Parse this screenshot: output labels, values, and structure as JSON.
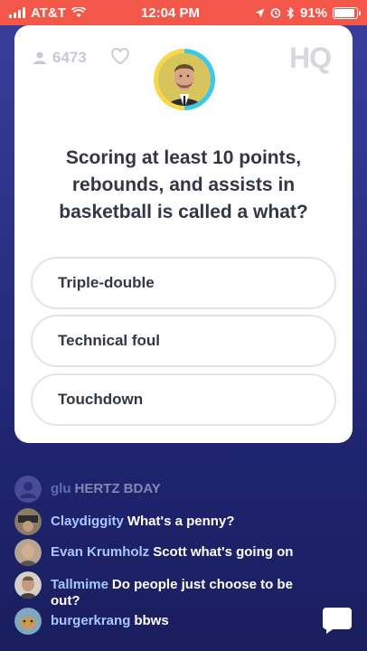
{
  "status_bar": {
    "carrier": "AT&T",
    "time": "12:04 PM",
    "battery": "91%",
    "battery_level": 0.91
  },
  "card": {
    "viewer_count": "6473",
    "logo": "HQ",
    "question": "Scoring at least 10 points, rebounds, and assists in basketball is called a what?",
    "answers": [
      {
        "label": "Triple-double"
      },
      {
        "label": "Technical foul"
      },
      {
        "label": "Touchdown"
      }
    ]
  },
  "chat": {
    "messages": [
      {
        "user": "glu",
        "text": "HERTZ BDAY"
      },
      {
        "user": "Claydiggity",
        "text": "What's a penny?"
      },
      {
        "user": "Evan Krumholz",
        "text": "Scott what's going on"
      },
      {
        "user": "Tallmime",
        "text": "Do people just choose to be out?"
      },
      {
        "user": "burgerkrang",
        "text": "bbws"
      }
    ]
  },
  "icons": {
    "signal": "signal-bars-icon",
    "wifi": "wifi-icon",
    "location": "location-arrow-icon",
    "alarm": "alarm-icon",
    "bluetooth": "bluetooth-icon",
    "battery": "battery-icon",
    "viewers": "person-icon",
    "heart": "heart-icon",
    "chat": "chat-bubble-icon"
  },
  "colors": {
    "status_bar": "#f2574a",
    "background_top": "#3a3f9e",
    "background_bottom": "#1a1e5e",
    "card": "#ffffff",
    "text_dark": "#333645",
    "username": "#a8c8ff",
    "timer_ring": "#3ec8e8"
  }
}
